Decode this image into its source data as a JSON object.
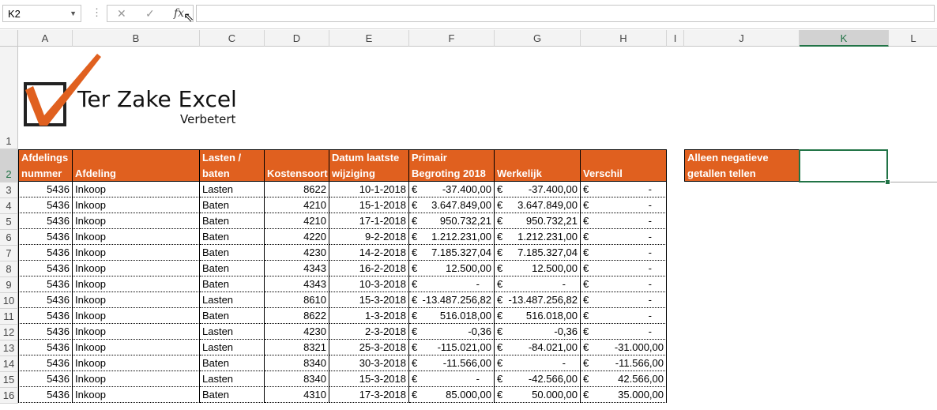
{
  "formula_bar": {
    "name_box": "K2",
    "cancel_icon": "✕",
    "enter_icon": "✓",
    "fx_label": "fx",
    "formula": ""
  },
  "columns": [
    "A",
    "B",
    "C",
    "D",
    "E",
    "F",
    "G",
    "H",
    "I",
    "J",
    "K",
    "L"
  ],
  "selected_column": "K",
  "rows": [
    "1",
    "2",
    "3",
    "4",
    "5",
    "6",
    "7",
    "8",
    "9",
    "10",
    "11",
    "12",
    "13",
    "14",
    "15",
    "16"
  ],
  "logo": {
    "title": "Ter Zake Excel",
    "subtitle": "Verbetert"
  },
  "table": {
    "headers": {
      "afdelingsnummer": [
        "Afdelings",
        "nummer"
      ],
      "afdeling": [
        "",
        "Afdeling"
      ],
      "lasten_baten": [
        "Lasten /",
        "baten"
      ],
      "kostensoort": [
        "",
        "Kostensoort"
      ],
      "datum": [
        "Datum laatste",
        "wijziging"
      ],
      "begroting": [
        "Primair",
        "Begroting 2018"
      ],
      "werkelijk": [
        "",
        "Werkelijk"
      ],
      "verschil": [
        "",
        "Verschil"
      ]
    },
    "currency_symbol": "€",
    "rows": [
      {
        "nr": "5436",
        "afd": "Inkoop",
        "lb": "Lasten",
        "ks": "8622",
        "datum": "10-1-2018",
        "beg": "-37.400,00",
        "werk": "-37.400,00",
        "versch": "-"
      },
      {
        "nr": "5436",
        "afd": "Inkoop",
        "lb": "Baten",
        "ks": "4210",
        "datum": "15-1-2018",
        "beg": "3.647.849,00",
        "werk": "3.647.849,00",
        "versch": "-"
      },
      {
        "nr": "5436",
        "afd": "Inkoop",
        "lb": "Baten",
        "ks": "4210",
        "datum": "17-1-2018",
        "beg": "950.732,21",
        "werk": "950.732,21",
        "versch": "-"
      },
      {
        "nr": "5436",
        "afd": "Inkoop",
        "lb": "Baten",
        "ks": "4220",
        "datum": "9-2-2018",
        "beg": "1.212.231,00",
        "werk": "1.212.231,00",
        "versch": "-"
      },
      {
        "nr": "5436",
        "afd": "Inkoop",
        "lb": "Baten",
        "ks": "4230",
        "datum": "14-2-2018",
        "beg": "7.185.327,04",
        "werk": "7.185.327,04",
        "versch": "-"
      },
      {
        "nr": "5436",
        "afd": "Inkoop",
        "lb": "Baten",
        "ks": "4343",
        "datum": "16-2-2018",
        "beg": "12.500,00",
        "werk": "12.500,00",
        "versch": "-"
      },
      {
        "nr": "5436",
        "afd": "Inkoop",
        "lb": "Baten",
        "ks": "4343",
        "datum": "10-3-2018",
        "beg": "-",
        "werk": "-",
        "versch": "-"
      },
      {
        "nr": "5436",
        "afd": "Inkoop",
        "lb": "Lasten",
        "ks": "8610",
        "datum": "15-3-2018",
        "beg": "-13.487.256,82",
        "werk": "-13.487.256,82",
        "versch": "-"
      },
      {
        "nr": "5436",
        "afd": "Inkoop",
        "lb": "Baten",
        "ks": "8622",
        "datum": "1-3-2018",
        "beg": "516.018,00",
        "werk": "516.018,00",
        "versch": "-"
      },
      {
        "nr": "5436",
        "afd": "Inkoop",
        "lb": "Lasten",
        "ks": "4230",
        "datum": "2-3-2018",
        "beg": "-0,36",
        "werk": "-0,36",
        "versch": "-"
      },
      {
        "nr": "5436",
        "afd": "Inkoop",
        "lb": "Lasten",
        "ks": "8321",
        "datum": "25-3-2018",
        "beg": "-115.021,00",
        "werk": "-84.021,00",
        "versch": "-31.000,00"
      },
      {
        "nr": "5436",
        "afd": "Inkoop",
        "lb": "Baten",
        "ks": "8340",
        "datum": "30-3-2018",
        "beg": "-11.566,00",
        "werk": "-",
        "versch": "-11.566,00"
      },
      {
        "nr": "5436",
        "afd": "Inkoop",
        "lb": "Lasten",
        "ks": "8340",
        "datum": "15-3-2018",
        "beg": "-",
        "werk": "-42.566,00",
        "versch": "42.566,00"
      },
      {
        "nr": "5436",
        "afd": "Inkoop",
        "lb": "Baten",
        "ks": "4310",
        "datum": "17-3-2018",
        "beg": "85.000,00",
        "werk": "50.000,00",
        "versch": "35.000,00"
      }
    ]
  },
  "side_box": {
    "label": [
      "Alleen negatieve",
      "getallen tellen"
    ],
    "value": ""
  },
  "colors": {
    "header_orange": "#e0601f",
    "excel_green": "#217346"
  }
}
